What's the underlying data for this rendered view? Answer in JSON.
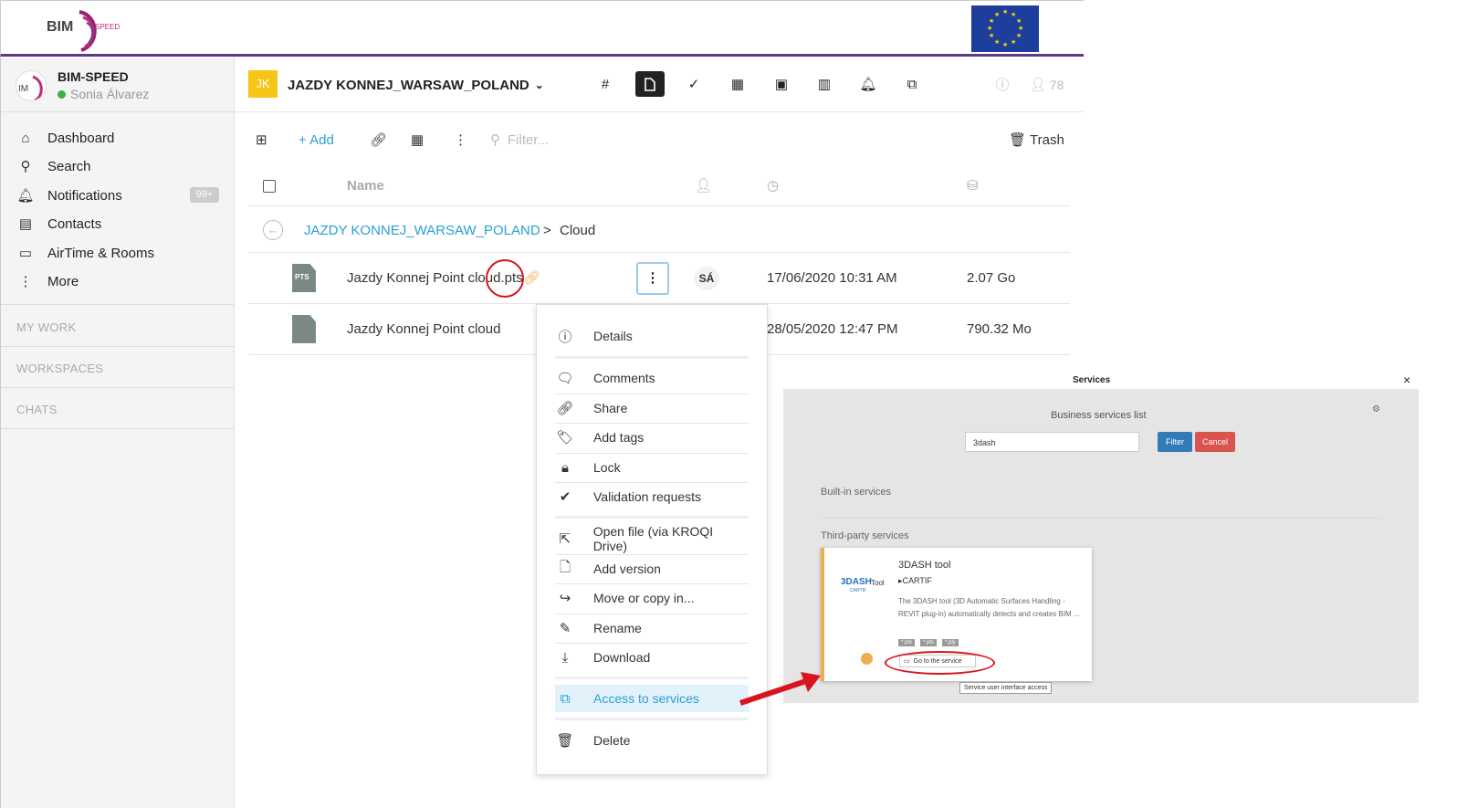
{
  "banner": {
    "logo_text": "BIM",
    "logo_sub": "SPEED"
  },
  "sidebar": {
    "app_name": "BIM-SPEED",
    "user_name": "Sonia Álvarez",
    "items": [
      {
        "label": "Dashboard",
        "icon": "home-icon"
      },
      {
        "label": "Search",
        "icon": "search-icon"
      },
      {
        "label": "Notifications",
        "icon": "bell-icon",
        "badge": "99+"
      },
      {
        "label": "Contacts",
        "icon": "contacts-icon"
      },
      {
        "label": "AirTime & Rooms",
        "icon": "video-icon"
      },
      {
        "label": "More",
        "icon": "more-icon"
      }
    ],
    "sections": [
      "MY WORK",
      "WORKSPACES",
      "CHATS"
    ]
  },
  "header": {
    "workspace_initials": "JK",
    "workspace_name": "JAZDY KONNEJ_WARSAW_POLAND",
    "member_count": "78"
  },
  "toolbar": {
    "add_label": "+ Add",
    "filter_placeholder": "Filter...",
    "trash_label": "Trash"
  },
  "table": {
    "name_header": "Name",
    "breadcrumb_root": "JAZDY KONNEJ_WARSAW_POLAND",
    "breadcrumb_sep": ">",
    "breadcrumb_current": "Cloud",
    "rows": [
      {
        "icon_text": "PTS",
        "name": "Jazdy Konnej Point cloud.pts",
        "owner": "SÁ",
        "date": "17/06/2020 10:31 AM",
        "size": "2.07 Go"
      },
      {
        "icon_text": "",
        "name": "Jazdy Konnej Point cloud",
        "owner": "",
        "date": "28/05/2020 12:47 PM",
        "size": "790.32 Mo"
      }
    ]
  },
  "context_menu": {
    "items": [
      {
        "label": "Details",
        "icon": "info-icon"
      },
      {
        "label": "Comments",
        "icon": "comment-icon"
      },
      {
        "label": "Share",
        "icon": "link-icon"
      },
      {
        "label": "Add tags",
        "icon": "tag-icon"
      },
      {
        "label": "Lock",
        "icon": "lock-icon"
      },
      {
        "label": "Validation requests",
        "icon": "check-circle-icon"
      },
      {
        "label": "Open file (via KROQI Drive)",
        "icon": "external-link-icon"
      },
      {
        "label": "Add version",
        "icon": "add-version-icon"
      },
      {
        "label": "Move or copy in...",
        "icon": "share-arrow-icon"
      },
      {
        "label": "Rename",
        "icon": "pencil-icon"
      },
      {
        "label": "Download",
        "icon": "download-icon"
      },
      {
        "label": "Access to services",
        "icon": "puzzle-icon"
      },
      {
        "label": "Delete",
        "icon": "trash-icon"
      }
    ]
  },
  "services": {
    "title": "Services",
    "close": "×",
    "list_title": "Business services list",
    "search_value": "3dash",
    "filter_label": "Filter",
    "cancel_label": "Cancel",
    "builtin_label": "Built-in services",
    "thirdparty_label": "Third-party services",
    "card": {
      "logo_text": "3DASH",
      "logo_sub": "Tool",
      "logo_org": "CARTIF",
      "name": "3DASH tool",
      "provider": "CARTIF",
      "description": "The 3DASH tool (3D Automatic Surfaces Handling - REVIT plug-in) automatically detects and creates BIM ...",
      "tags": [
        "*.ptx",
        "*.pts",
        "*.ply"
      ],
      "go_label": "Go to the service",
      "tooltip": "Service user interface access"
    }
  },
  "colors": {
    "accent": "#2a9fd6",
    "brand_purple": "#5b3a8c",
    "annotation_red": "#d9141c",
    "workspace_badge": "#f5c518"
  }
}
